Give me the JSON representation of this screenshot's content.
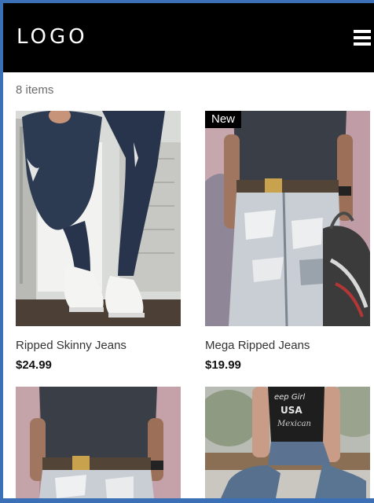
{
  "header": {
    "logo": "LOGO",
    "menu_icon": "hamburger-menu-icon"
  },
  "catalog": {
    "count_label": "8 items",
    "products": [
      {
        "name": "Ripped Skinny Jeans",
        "price": "$24.99",
        "badge": "",
        "image": "skinny-jeans-sneakers-photo"
      },
      {
        "name": "Mega Ripped Jeans",
        "price": "$19.99",
        "badge": "New",
        "image": "distressed-jeans-bag-photo"
      },
      {
        "name": "",
        "price": "",
        "badge": "",
        "image": "distressed-jeans-belt-photo"
      },
      {
        "name": "",
        "price": "",
        "badge": "",
        "image": "graphic-tee-jeans-photo"
      }
    ]
  },
  "colors": {
    "header_bg": "#000000",
    "badge_bg": "#000000",
    "frame_border": "#3b6fb6"
  }
}
